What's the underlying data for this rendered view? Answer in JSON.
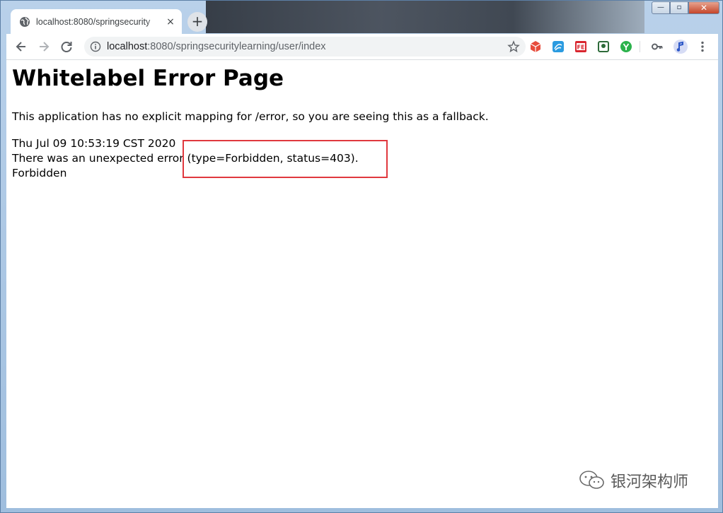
{
  "browser": {
    "tab": {
      "title": "localhost:8080/springsecurity",
      "close_glyph": "×"
    },
    "new_tab_glyph": "+",
    "window_buttons": {
      "minimize": "—",
      "maximize": "▫",
      "close": "✕"
    },
    "address_bar": {
      "host": "localhost",
      "path": ":8080/springsecuritylearning/user/index"
    },
    "icons": [
      "back-arrow-icon",
      "forward-arrow-icon",
      "reload-icon",
      "info-icon",
      "star-icon",
      "cube-extension-icon",
      "chat-extension-icon",
      "fe-extension-icon",
      "frame-extension-icon",
      "y-extension-icon",
      "key-icon",
      "profile-avatar-icon",
      "menu-dots-icon"
    ]
  },
  "page": {
    "heading": "Whitelabel Error Page",
    "message": "This application has no explicit mapping for /error, so you are seeing this as a fallback.",
    "timestamp": "Thu Jul 09 10:53:19 CST 2020",
    "error_line": "There was an unexpected error (type=Forbidden, status=403).",
    "error_detail": "Forbidden"
  },
  "watermark": {
    "text": "银河架构师"
  },
  "colors": {
    "highlight_border": "#e0383e",
    "window_frame": "#b9d1ea"
  }
}
